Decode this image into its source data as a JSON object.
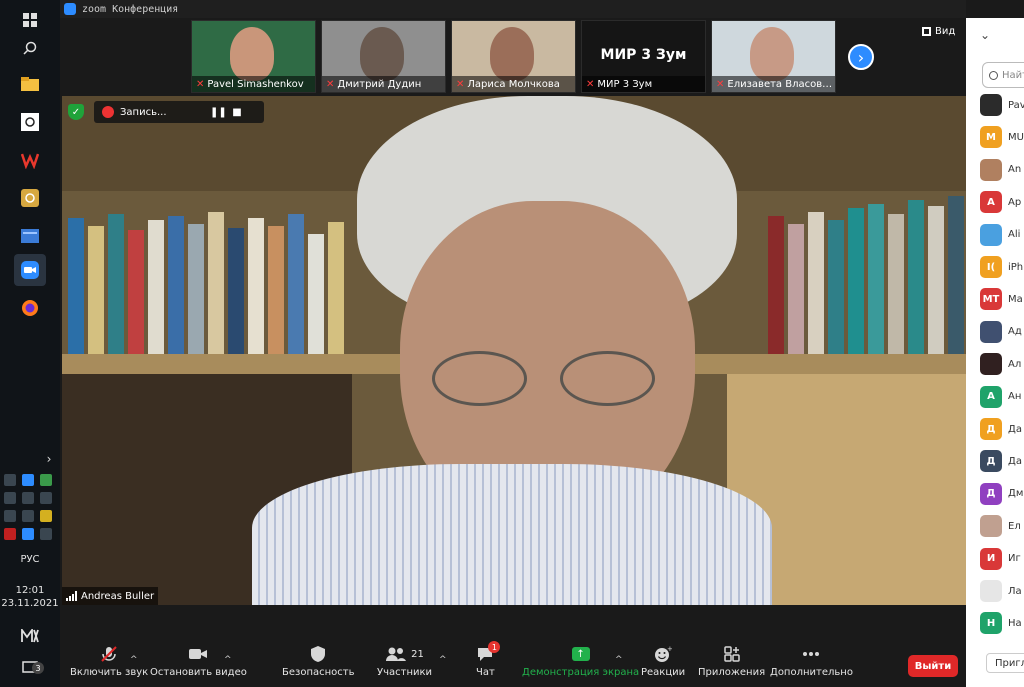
{
  "window": {
    "title": "zoom Конференция"
  },
  "taskbar": {
    "language": "РУС",
    "time": "12:01",
    "date": "23.11.2021",
    "notification_count": "3"
  },
  "gallery": {
    "thumbnails": [
      {
        "name": "Pavel Simashenkov",
        "bg": "#2f6b45",
        "face": "#c9967a"
      },
      {
        "name": "Дмитрий Дудин",
        "bg": "#8f8f8f",
        "face": "#6a5a50"
      },
      {
        "name": "Лариса Молчкова",
        "bg": "#c9b9a1",
        "face": "#9b6e59"
      },
      {
        "name": "МИР 3 Зум",
        "bg": "#151515",
        "face": "",
        "display_text": "МИР 3 Зум"
      },
      {
        "name": "Елизавета Власова УП...",
        "bg": "#cfd8dd",
        "face": "#c79a86"
      }
    ],
    "view_label": "Вид"
  },
  "main": {
    "recording_label": "Запись...",
    "speaker_name": "Andreas Buller"
  },
  "toolbar": {
    "mute_label": "Включить звук",
    "video_label": "Остановить видео",
    "security_label": "Безопасность",
    "participants_label": "Участники",
    "participants_count": "21",
    "chat_label": "Чат",
    "chat_badge": "1",
    "share_label": "Демонстрация экрана",
    "reactions_label": "Реакции",
    "apps_label": "Приложения",
    "more_label": "Дополнительно",
    "leave_label": "Выйти"
  },
  "panel": {
    "search_placeholder": "Найт",
    "participants": [
      {
        "initials": "",
        "name": "Pav",
        "color": "#2b2b2b"
      },
      {
        "initials": "M",
        "name": "MU",
        "color": "#f0a020"
      },
      {
        "initials": "",
        "name": "An",
        "color": "#b08060"
      },
      {
        "initials": "A",
        "name": "Ар",
        "color": "#d93838"
      },
      {
        "initials": "",
        "name": "Ali",
        "color": "#4aa0e0"
      },
      {
        "initials": "I(",
        "name": "iPh",
        "color": "#f0a020"
      },
      {
        "initials": "MT",
        "name": "Ma",
        "color": "#d93838"
      },
      {
        "initials": "",
        "name": "Ад",
        "color": "#405070"
      },
      {
        "initials": "",
        "name": "Ал",
        "color": "#302020"
      },
      {
        "initials": "A",
        "name": "Ан",
        "color": "#1fa36a"
      },
      {
        "initials": "Д",
        "name": "Да",
        "color": "#f0a020"
      },
      {
        "initials": "Д",
        "name": "Да",
        "color": "#3a4a60"
      },
      {
        "initials": "Д",
        "name": "Дм",
        "color": "#9040c0"
      },
      {
        "initials": "",
        "name": "Ел",
        "color": "#c0a090"
      },
      {
        "initials": "И",
        "name": "Иг",
        "color": "#d93838"
      },
      {
        "initials": "",
        "name": "Ла",
        "color": "#e6e6e6"
      },
      {
        "initials": "Н",
        "name": "На",
        "color": "#1fa36a"
      }
    ],
    "bottom_button": "Пригл"
  }
}
